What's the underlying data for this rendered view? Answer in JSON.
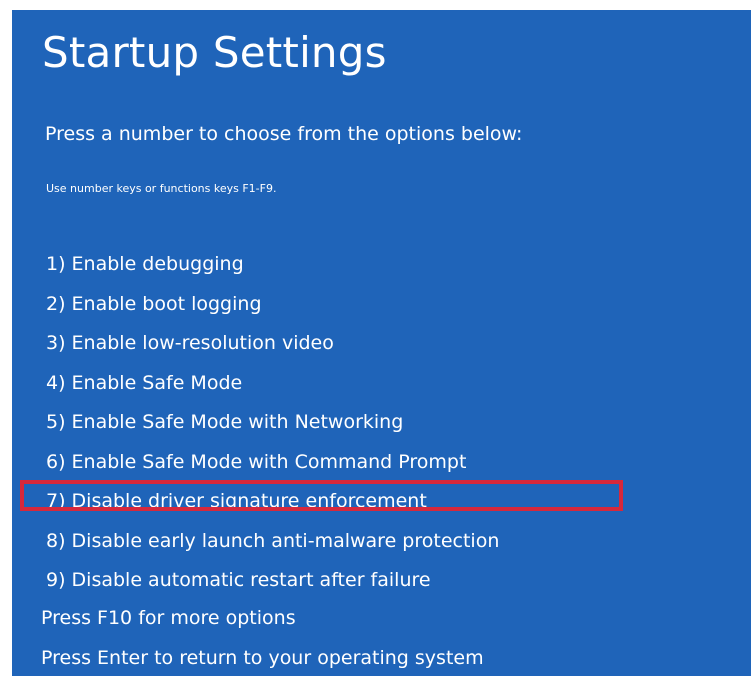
{
  "screen": {
    "title": "Startup Settings",
    "subtitle": "Press a number to choose from the options below:",
    "hint": "Use number keys or functions keys F1-F9.",
    "background_color": "#1f64b9",
    "highlight_color": "#d6283c"
  },
  "options": [
    {
      "label": "1) Enable debugging"
    },
    {
      "label": "2) Enable boot logging"
    },
    {
      "label": "3) Enable low-resolution video"
    },
    {
      "label": "4) Enable Safe Mode"
    },
    {
      "label": "5) Enable Safe Mode with Networking"
    },
    {
      "label": "6) Enable Safe Mode with Command Prompt"
    },
    {
      "label": "7) Disable driver signature enforcement",
      "highlighted": true
    },
    {
      "label": "8) Disable early launch anti-malware protection"
    },
    {
      "label": "9) Disable automatic restart after failure"
    }
  ],
  "footer": {
    "more_options": "Press F10 for more options",
    "return": "Press Enter to return to your operating system"
  }
}
